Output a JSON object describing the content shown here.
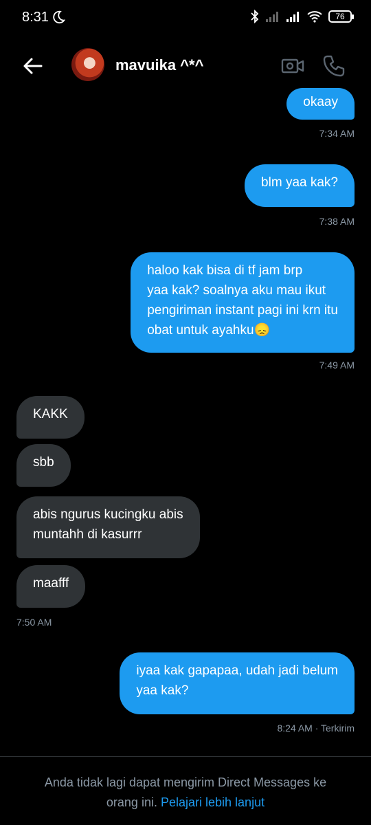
{
  "status_bar": {
    "time": "8:31",
    "battery": "76"
  },
  "header": {
    "contact_name": "mavuika ^*^"
  },
  "messages": [
    {
      "text": "okaay",
      "time": "7:34 AM"
    },
    {
      "text": "blm yaa kak?",
      "time": "7:38 AM"
    },
    {
      "text": "haloo kak bisa di tf jam brp\nyaa kak? soalnya aku mau ikut\npengiriman instant pagi ini krn itu\nobat untuk ayahku😞",
      "time": "7:49 AM"
    },
    {
      "text": "KAKK"
    },
    {
      "text": "sbb"
    },
    {
      "text": "abis ngurus kucingku abis\nmuntahh di kasurrr"
    },
    {
      "text": "maafff",
      "time": "7:50 AM"
    },
    {
      "text": "iyaa kak gapapaa, udah jadi belum\nyaa kak?",
      "time": "8:24 AM · Terkirim"
    }
  ],
  "footer": {
    "notice": "Anda tidak lagi dapat mengirim Direct Messages ke orang ini.",
    "link": "Pelajari lebih lanjut"
  },
  "colors": {
    "outgoing_bubble": "#1d9bf0",
    "incoming_bubble": "#2f3336",
    "background": "#000000"
  }
}
